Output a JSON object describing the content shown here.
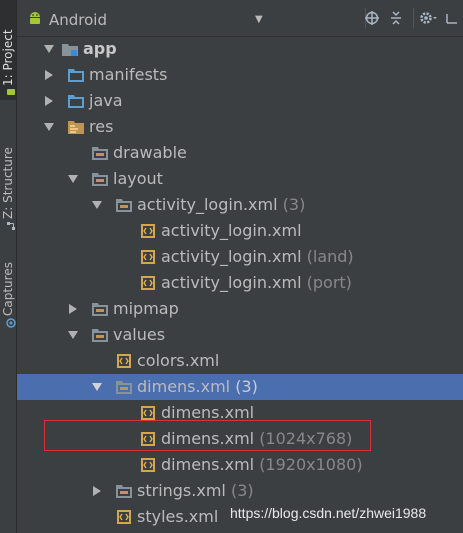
{
  "side_tabs": {
    "project": "1: Project",
    "structure": "Z: Structure",
    "captures": "Captures"
  },
  "toolbar": {
    "view": "Android",
    "icons": [
      "android-icon",
      "chevron-down-icon",
      "locate-icon",
      "collapse-all-icon",
      "gear-icon",
      "hide-icon"
    ]
  },
  "tree": {
    "app": "app",
    "manifests": "manifests",
    "java": "java",
    "res": "res",
    "drawable": "drawable",
    "layout": "layout",
    "activity_login_group": "activity_login.xml",
    "activity_login_group_count": "(3)",
    "activity_login_1": "activity_login.xml",
    "activity_login_2": "activity_login.xml",
    "activity_login_2_q": "(land)",
    "activity_login_3": "activity_login.xml",
    "activity_login_3_q": "(port)",
    "mipmap": "mipmap",
    "values": "values",
    "colors": "colors.xml",
    "dimens_group": "dimens.xml",
    "dimens_group_count": "(3)",
    "dimens_1": "dimens.xml",
    "dimens_2": "dimens.xml",
    "dimens_2_q": "(1024x768)",
    "dimens_3": "dimens.xml",
    "dimens_3_q": "(1920x1080)",
    "strings_group": "strings.xml",
    "strings_group_count": "(3)",
    "styles": "styles.xml"
  },
  "watermark": "https://blog.csdn.net/zhwei1988",
  "colors": {
    "background": "#3c3f41",
    "selection": "#4b6eaf",
    "folder": "#87939a",
    "res_folder": "#c09553",
    "source_folder": "#5a9fd4",
    "xml_file": "#d6a74a",
    "highlight": "#d4333a"
  }
}
